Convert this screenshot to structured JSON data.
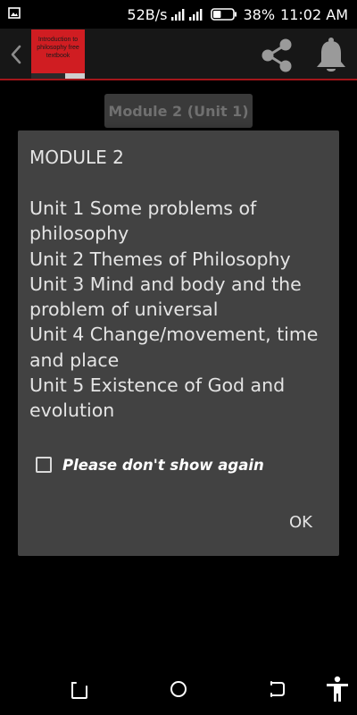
{
  "status_bar": {
    "net_speed": "52B/s",
    "battery_percent": "38%",
    "time": "11:02 AM",
    "battery_level": 0.38,
    "icons": [
      "gallery-icon",
      "signal-icon",
      "battery-icon"
    ]
  },
  "app_bar": {
    "book_cover_text": "Introduction to philosophy free textbook",
    "accent_color": "#a4161a",
    "icons": [
      "back-chevron-icon",
      "share-icon",
      "bell-icon"
    ]
  },
  "content": {
    "module_chip_label": "Module 2 (Unit 1)"
  },
  "dialog": {
    "title": "MODULE 2",
    "units": [
      "Unit 1 Some problems of philosophy",
      "Unit 2 Themes of Philosophy",
      "Unit 3 Mind and body and the problem of universal",
      "Unit 4 Change/movement, time and place",
      "Unit 5 Existence of God and evolution"
    ],
    "dont_show_label": "Please don't show again",
    "dont_show_checked": false,
    "ok_label": "OK"
  },
  "nav_bar": {
    "icons": [
      "back-icon",
      "home-icon",
      "recent-apps-icon",
      "accessibility-icon"
    ]
  }
}
